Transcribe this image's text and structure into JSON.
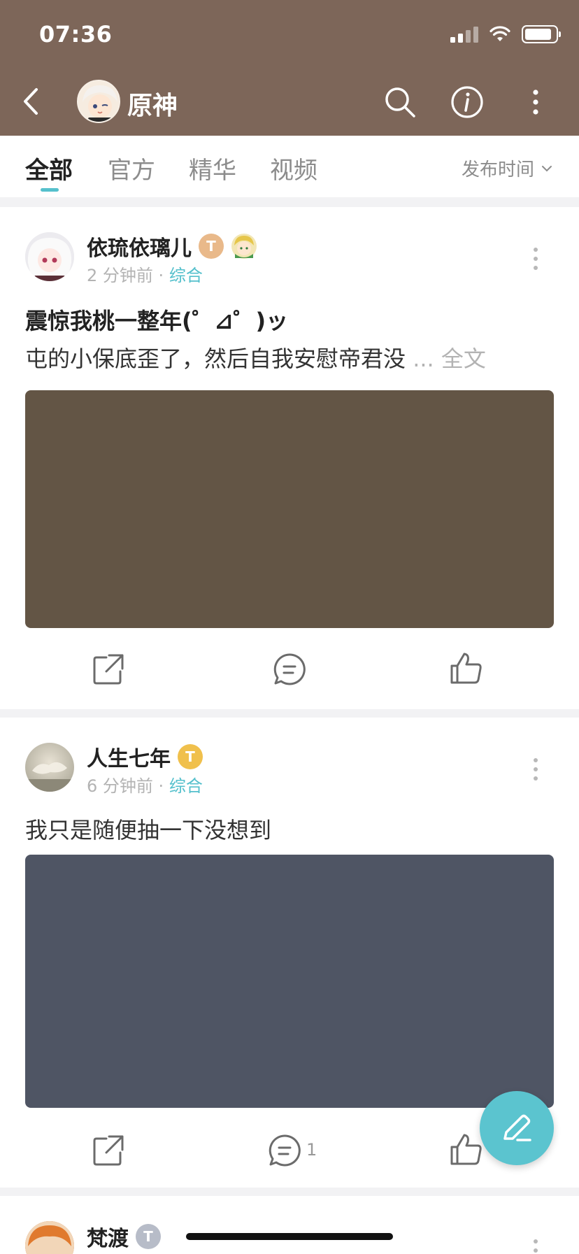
{
  "status_bar": {
    "time": "07:36"
  },
  "header": {
    "community_name": "原神"
  },
  "tabs": [
    {
      "label": "全部",
      "active": true
    },
    {
      "label": "官方",
      "active": false
    },
    {
      "label": "精华",
      "active": false
    },
    {
      "label": "视频",
      "active": false
    }
  ],
  "sort": {
    "label": "发布时间"
  },
  "posts": [
    {
      "author": "依琉依璃儿",
      "time": "2 分钟前",
      "category": "综合",
      "title": "震惊我桃一整年(゜⊿゜)ッ",
      "body": "屯的小保底歪了，然后自我安慰帝君没",
      "more": "... 全文",
      "image_color": "#635545",
      "comment_count": ""
    },
    {
      "author": "人生七年",
      "time": "6 分钟前",
      "category": "综合",
      "title": "",
      "body": "我只是随便抽一下没想到",
      "more": "",
      "image_color": "#4f5564",
      "comment_count": "1"
    },
    {
      "author": "梵渡"
    }
  ],
  "meta_separator": "·",
  "colors": {
    "header": "#7d6659",
    "accent": "#55c0cc",
    "fab": "#5bc4cf"
  }
}
